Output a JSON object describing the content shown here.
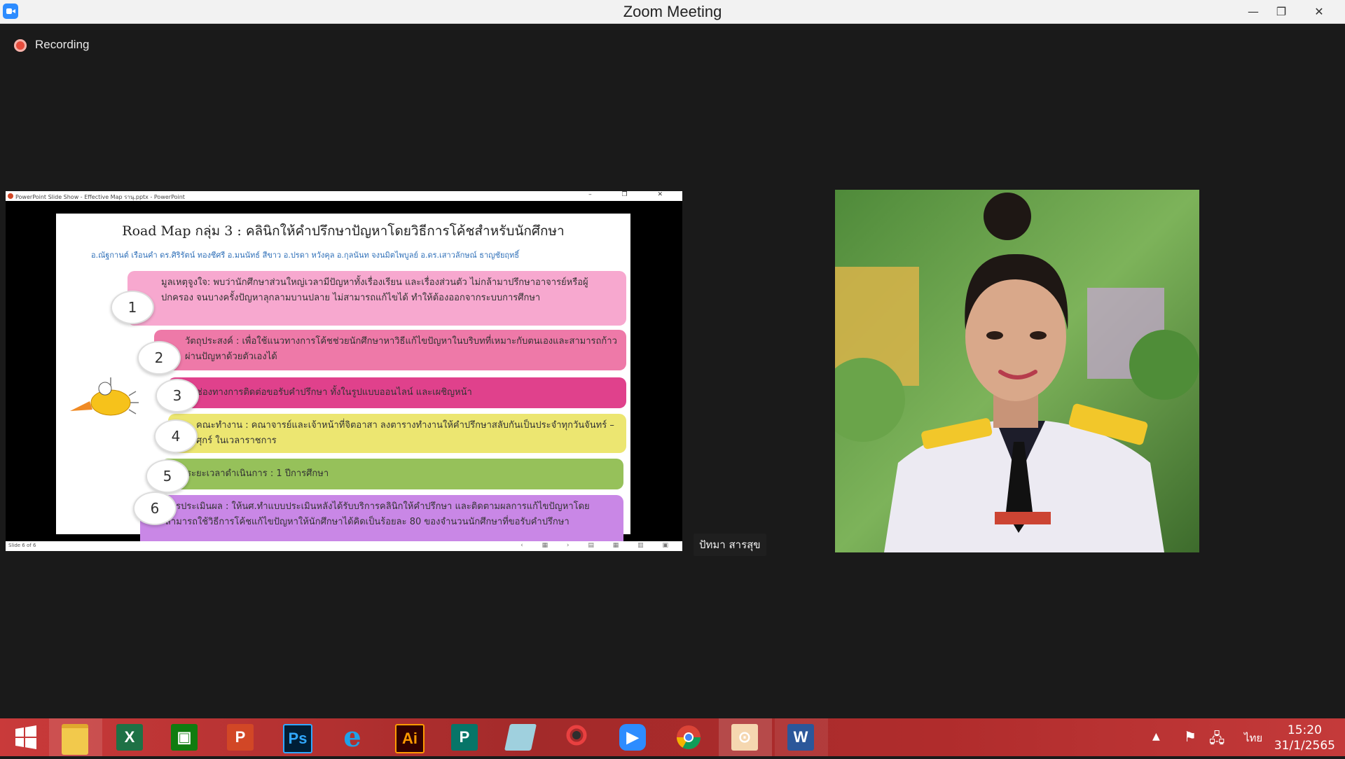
{
  "window": {
    "title": "Zoom Meeting",
    "controls": {
      "minimize": "—",
      "maximize": "❐",
      "close": "✕"
    }
  },
  "recording": {
    "label": "Recording"
  },
  "shared_window": {
    "title": "PowerPoint Slide Show - Effective Map รานุ.pptx - PowerPoint",
    "controls": "– ❐ ✕",
    "status": "Slide 6 of 6",
    "nav": "‹ ▦ › ▤ ▦ ▥ ▣",
    "slide": {
      "title": "Road Map กลุ่ม 3 : คลินิกให้คำปรึกษาปัญหาโดยวิธีการโค้ชสำหรับนักศึกษา",
      "authors": "อ.ณัฐกานต์ เรือนคำ ดร.ศิริรัตน์ ทองชีศรี อ.มนนัทธ์ สีขาว อ.ปรดา หวังคุล อ.กุลนันท จงนมิตไพบูลย์ อ.ดร.เสาวลักษณ์ ธาญชัยฤทธิ์",
      "items": [
        {
          "num": "1",
          "text": "มูลเหตุจูงใจ: พบว่านักศึกษาส่วนใหญ่เวลามีปัญหาทั้งเรื่องเรียน และเรื่องส่วนตัว ไม่กล้ามาปรึกษาอาจารย์หรือผู้ปกครอง จนบางครั้งปัญหาลุกลามบานปลาย ไม่สามารถแก้ไขได้ ทำให้ต้องออกจากระบบการศึกษา",
          "color": "#f7a8cf"
        },
        {
          "num": "2",
          "text": "วัตถุประสงค์ : เพื่อใช้แนวทางการโค้ชช่วยนักศึกษาหาวิธีแก้ไขปัญหาในบริบทที่เหมาะกับตนเองและสามารถก้าวผ่านปัญหาด้วยตัวเองได้",
          "color": "#ee79a8"
        },
        {
          "num": "3",
          "text": "ช่องทางการติดต่อขอรับคำปรึกษา ทั้งในรูปแบบออนไลน์ และเผชิญหน้า",
          "color": "#e0418c"
        },
        {
          "num": "4",
          "text": "คณะทำงาน : คณาจารย์และเจ้าหน้าที่จิตอาสา ลงตารางทำงานให้คำปรึกษาสลับกันเป็นประจำทุกวันจันทร์ – ศุกร์ ในเวลาราชการ",
          "color": "#ece671"
        },
        {
          "num": "5",
          "text": "ระยะเวลาดำเนินการ : 1 ปีการศึกษา",
          "color": "#96c15a"
        },
        {
          "num": "6",
          "text": "การประเมินผล : ให้นศ.ทำแบบประเมินหลังได้รับบริการคลินิกให้คำปรึกษา และติดตามผลการแก้ไขปัญหาโดยสามารถใช้วิธีการโค้ชแก้ไขปัญหาให้นักศึกษาได้คิดเป็นร้อยละ 80 ของจำนวนนักศึกษาที่ขอรับคำปรึกษา",
          "color": "#c987e6"
        }
      ]
    }
  },
  "participant": {
    "name": "ปัทมา สารสุข"
  },
  "taskbar": {
    "apps": [
      {
        "name": "start",
        "label": ""
      },
      {
        "name": "file-explorer",
        "label": ""
      },
      {
        "name": "excel",
        "label": "X",
        "color": "#1e7145"
      },
      {
        "name": "store",
        "label": "",
        "color": "#107c10"
      },
      {
        "name": "powerpoint",
        "label": "P",
        "color": "#d24726"
      },
      {
        "name": "photoshop",
        "label": "Ps",
        "color": "#001e36"
      },
      {
        "name": "internet-explorer",
        "label": "e",
        "color": "#1ea1e8"
      },
      {
        "name": "illustrator",
        "label": "Ai",
        "color": "#330000"
      },
      {
        "name": "publisher",
        "label": "P",
        "color": "#077568"
      },
      {
        "name": "notepad",
        "label": "",
        "color": "#6fb2c8"
      },
      {
        "name": "photoscape",
        "label": "PHOTOSCAPE",
        "color": "#8b2a2a"
      },
      {
        "name": "zoom",
        "label": "",
        "color": "#2d8cff"
      },
      {
        "name": "chrome",
        "label": "",
        "color": "#ffffff"
      },
      {
        "name": "photos",
        "label": "",
        "color": "#f0c060"
      },
      {
        "name": "word",
        "label": "W",
        "color": "#2b579a"
      }
    ],
    "language": "ไทย",
    "time": "15:20",
    "date": "31/1/2565"
  }
}
